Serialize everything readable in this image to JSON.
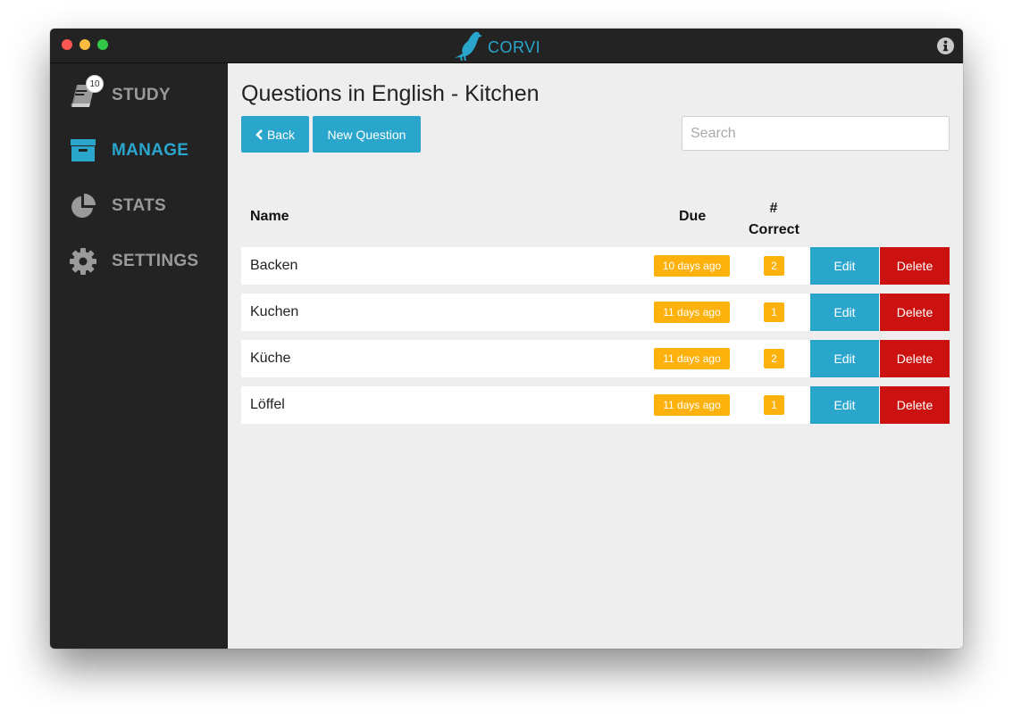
{
  "app": {
    "name": "CORVI"
  },
  "sidebar": {
    "items": [
      {
        "label": "STUDY",
        "icon": "book-icon",
        "badge": "10",
        "active": false
      },
      {
        "label": "MANAGE",
        "icon": "archive-icon",
        "active": true
      },
      {
        "label": "STATS",
        "icon": "pie-chart-icon",
        "active": false
      },
      {
        "label": "SETTINGS",
        "icon": "gear-icon",
        "active": false
      }
    ]
  },
  "main": {
    "title": "Questions in English - Kitchen",
    "back_label": "Back",
    "new_question_label": "New Question",
    "search_placeholder": "Search",
    "search_value": ""
  },
  "table": {
    "headers": {
      "name": "Name",
      "due": "Due",
      "correct_line1": "#",
      "correct_line2": "Correct"
    },
    "rows": [
      {
        "name": "Backen",
        "due": "10 days ago",
        "correct": "2",
        "edit_label": "Edit",
        "delete_label": "Delete"
      },
      {
        "name": "Kuchen",
        "due": "11 days ago",
        "correct": "1",
        "edit_label": "Edit",
        "delete_label": "Delete"
      },
      {
        "name": "Küche",
        "due": "11 days ago",
        "correct": "2",
        "edit_label": "Edit",
        "delete_label": "Delete"
      },
      {
        "name": "Löffel",
        "due": "11 days ago",
        "correct": "1",
        "edit_label": "Edit",
        "delete_label": "Delete"
      }
    ]
  },
  "colors": {
    "accent": "#2aa6cc",
    "sidebar_bg": "#232323",
    "badge_yellow": "#fdb10d",
    "danger": "#cc1111",
    "content_bg": "#eeeeee"
  }
}
